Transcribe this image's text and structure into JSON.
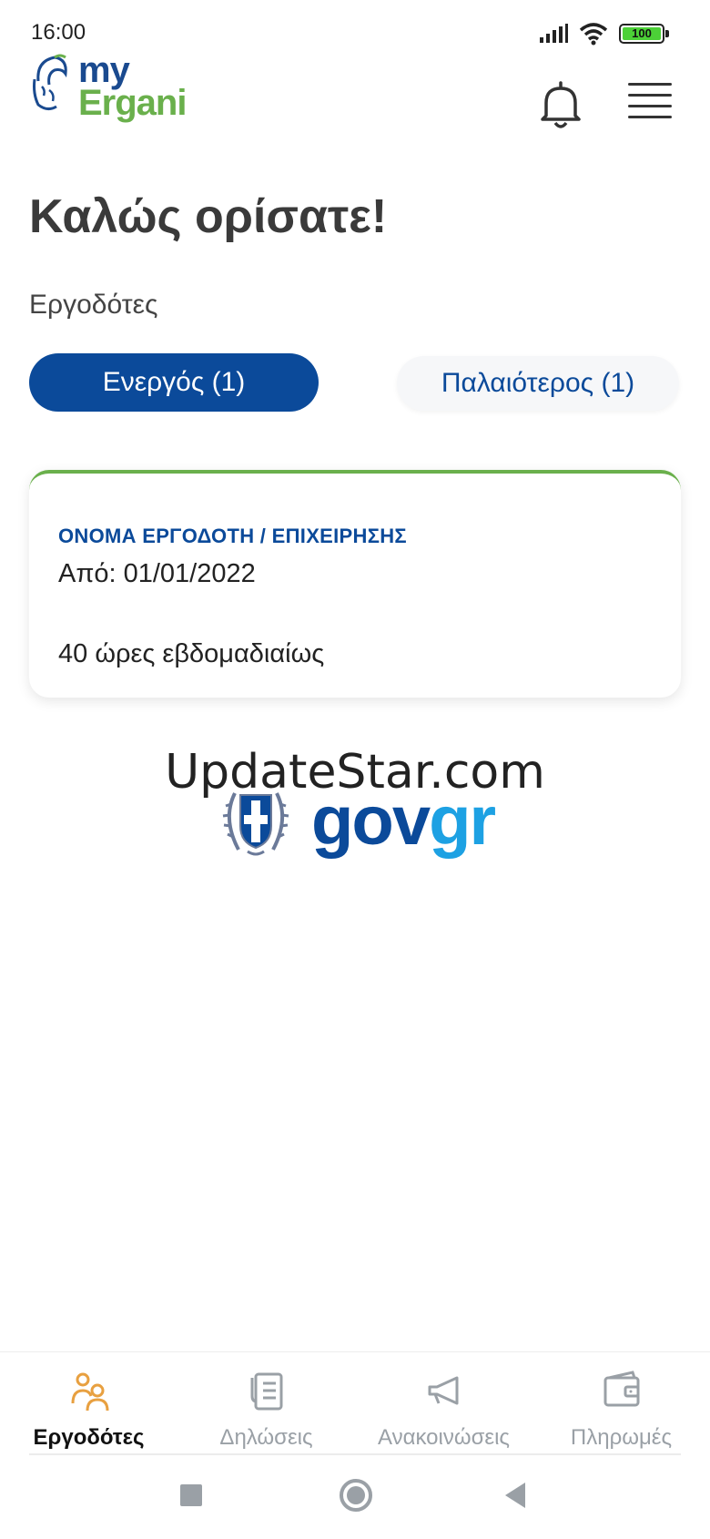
{
  "status_bar": {
    "time": "16:00",
    "battery": "100",
    "icons": [
      "signal-icon",
      "wifi-icon",
      "battery-icon"
    ]
  },
  "header": {
    "logo_my": "my",
    "logo_ergani": "Ergani",
    "icons": [
      "bell-icon",
      "menu-icon"
    ]
  },
  "main": {
    "welcome": "Καλώς ορίσατε!",
    "section_label": "Εργοδότες",
    "tabs": [
      {
        "label": "Ενεργός (1)",
        "active": true
      },
      {
        "label": "Παλαιότερος (1)",
        "active": false
      }
    ],
    "card": {
      "employer_name": "ΟΝΟΜΑ ΕΡΓΟΔΟΤΗ / ΕΠΙΧΕΙΡΗΣΗΣ",
      "from": "Από: 01/01/2022",
      "hours": "40 ώρες εβδομαδιαίως"
    },
    "watermark": "UpdateStar.com",
    "govgr": {
      "gov": "gov",
      "gr": "gr"
    }
  },
  "bottom_nav": {
    "items": [
      {
        "label": "Εργοδότες",
        "icon": "people-icon",
        "active": true
      },
      {
        "label": "Δηλώσεις",
        "icon": "document-icon",
        "active": false
      },
      {
        "label": "Ανακοινώσεις",
        "icon": "megaphone-icon",
        "active": false
      },
      {
        "label": "Πληρωμές",
        "icon": "wallet-icon",
        "active": false
      }
    ]
  },
  "colors": {
    "primary": "#0b4a9a",
    "accent_green": "#6ab04c",
    "active_icon": "#e8a040",
    "inactive": "#9aa0a6"
  }
}
